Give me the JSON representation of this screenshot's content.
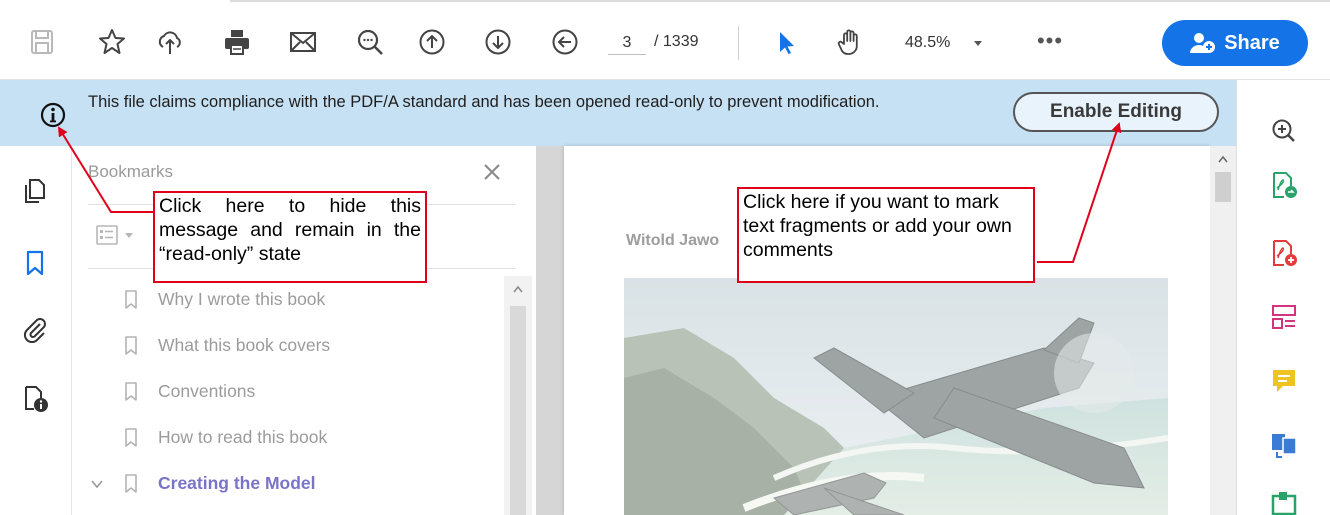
{
  "toolbar": {
    "current_page": "3",
    "page_total": "/ 1339",
    "zoom": "48.5%",
    "more": "•••",
    "share_label": "Share"
  },
  "infobar": {
    "message": "This file claims compliance with the PDF/A standard and has been opened read-only to prevent modification.",
    "enable_editing_label": "Enable Editing"
  },
  "bookmarks": {
    "title": "Bookmarks",
    "items": [
      {
        "label": "Why I wrote this book",
        "active": false
      },
      {
        "label": "What this book covers",
        "active": false
      },
      {
        "label": "Conventions",
        "active": false
      },
      {
        "label": "How to read this book",
        "active": false
      },
      {
        "label": "Creating the Model",
        "active": true
      }
    ]
  },
  "document": {
    "author_text": "Witold Jawo"
  },
  "annotations": {
    "left": "Click here to hide this message and remain in the “read-only” state",
    "right": "Click here if you want to mark text fragments or add your own comments"
  },
  "colors": {
    "accent": "#1473e6",
    "infobar": "#c7e1f4",
    "callout_border": "#e0001b",
    "active_bookmark": "#7a74c8"
  }
}
